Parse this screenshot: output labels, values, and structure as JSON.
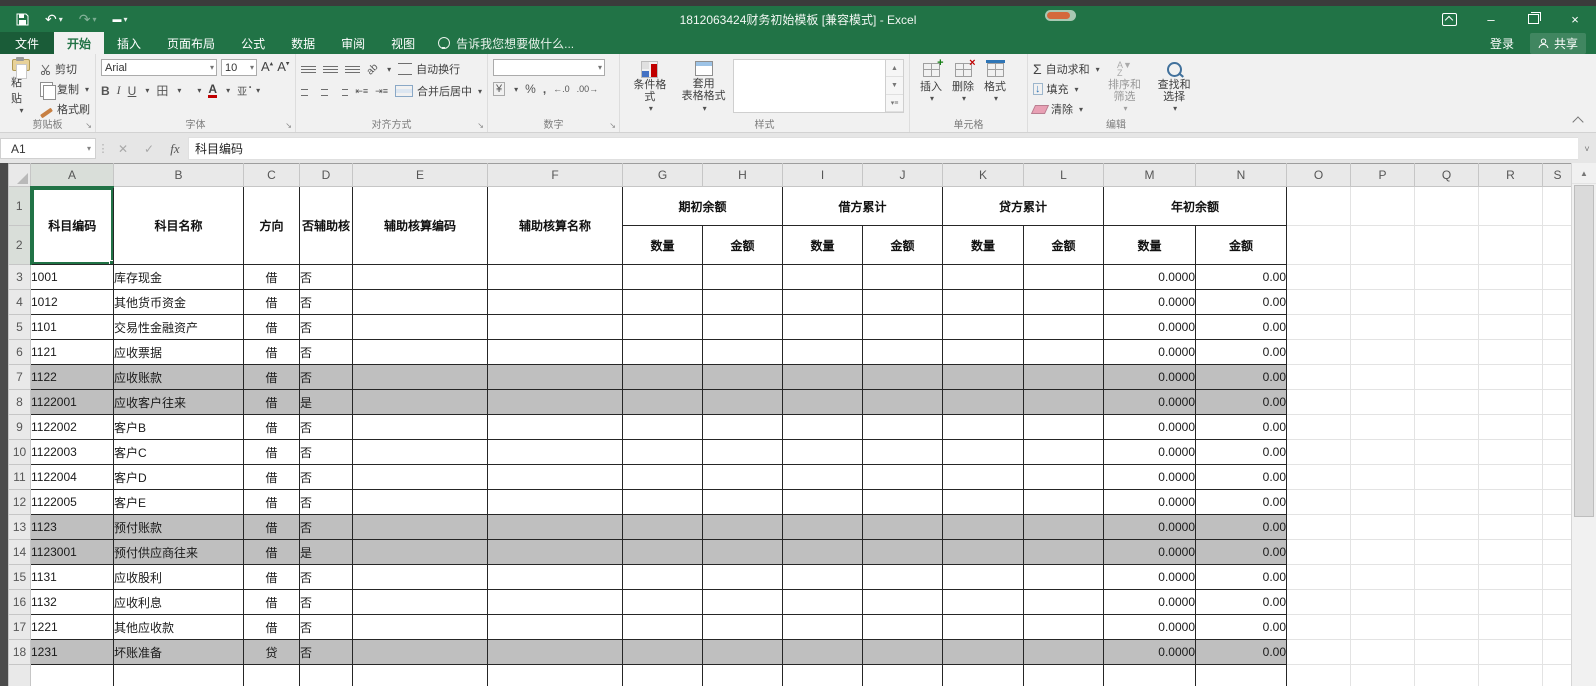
{
  "window": {
    "title": "1812063424财务初始模板  [兼容模式] - Excel",
    "sign_in": "登录",
    "share": "共享"
  },
  "tabs": {
    "file": "文件",
    "items": [
      "开始",
      "插入",
      "页面布局",
      "公式",
      "数据",
      "审阅",
      "视图"
    ],
    "selected": "开始",
    "tell_me": "告诉我您想要做什么..."
  },
  "ribbon": {
    "clipboard": {
      "group": "剪贴板",
      "paste": "粘贴",
      "cut": "剪切",
      "copy": "复制",
      "format_painter": "格式刷"
    },
    "font": {
      "group": "字体",
      "name_value": "Arial",
      "size_value": "10"
    },
    "alignment": {
      "group": "对齐方式",
      "wrap": "自动换行",
      "merge": "合并后居中"
    },
    "number": {
      "group": "数字"
    },
    "styles": {
      "group": "样式",
      "conditional": "条件格式",
      "format_table_line1": "套用",
      "format_table_line2": "表格格式"
    },
    "cells": {
      "group": "单元格",
      "insert": "插入",
      "delete": "删除",
      "format": "格式"
    },
    "editing": {
      "group": "编辑",
      "autosum": "自动求和",
      "fill": "填充",
      "clear": "清除",
      "sort": "排序和筛选",
      "find": "查找和选择"
    }
  },
  "formula_bar": {
    "name_box": "A1",
    "content": "科目编码"
  },
  "sheet": {
    "col_letters": [
      "A",
      "B",
      "C",
      "D",
      "E",
      "F",
      "G",
      "H",
      "I",
      "J",
      "K",
      "L",
      "M",
      "N",
      "O",
      "P",
      "Q",
      "R",
      "S"
    ],
    "selected_col": "A",
    "selected_rows": [
      "1",
      "2"
    ],
    "top_headers": [
      "科目编码",
      "科目名称",
      "方向",
      "否辅助核",
      "辅助核算编码",
      "辅助核算名称"
    ],
    "group_headers": [
      "期初余额",
      "借方累计",
      "贷方累计",
      "年初余额"
    ],
    "sub_headers": [
      "数量",
      "金额",
      "数量",
      "金额",
      "数量",
      "金额",
      "数量",
      "金额"
    ],
    "rows": [
      {
        "r": "3",
        "code": "1001",
        "name": "库存现金",
        "dir": "借",
        "aux": "否",
        "qty": "0.0000",
        "amt": "0.00",
        "gray": false
      },
      {
        "r": "4",
        "code": "1012",
        "name": "其他货币资金",
        "dir": "借",
        "aux": "否",
        "qty": "0.0000",
        "amt": "0.00",
        "gray": false
      },
      {
        "r": "5",
        "code": "1101",
        "name": "交易性金融资产",
        "dir": "借",
        "aux": "否",
        "qty": "0.0000",
        "amt": "0.00",
        "gray": false
      },
      {
        "r": "6",
        "code": "1121",
        "name": "应收票据",
        "dir": "借",
        "aux": "否",
        "qty": "0.0000",
        "amt": "0.00",
        "gray": false
      },
      {
        "r": "7",
        "code": "1122",
        "name": "应收账款",
        "dir": "借",
        "aux": "否",
        "qty": "0.0000",
        "amt": "0.00",
        "gray": true
      },
      {
        "r": "8",
        "code": "1122001",
        "name": "应收客户往来",
        "dir": "借",
        "aux": "是",
        "qty": "0.0000",
        "amt": "0.00",
        "gray": true
      },
      {
        "r": "9",
        "code": "1122002",
        "name": "客户B",
        "dir": "借",
        "aux": "否",
        "qty": "0.0000",
        "amt": "0.00",
        "gray": false
      },
      {
        "r": "10",
        "code": "1122003",
        "name": "客户C",
        "dir": "借",
        "aux": "否",
        "qty": "0.0000",
        "amt": "0.00",
        "gray": false
      },
      {
        "r": "11",
        "code": "1122004",
        "name": "客户D",
        "dir": "借",
        "aux": "否",
        "qty": "0.0000",
        "amt": "0.00",
        "gray": false
      },
      {
        "r": "12",
        "code": "1122005",
        "name": "客户E",
        "dir": "借",
        "aux": "否",
        "qty": "0.0000",
        "amt": "0.00",
        "gray": false
      },
      {
        "r": "13",
        "code": "1123",
        "name": "预付账款",
        "dir": "借",
        "aux": "否",
        "qty": "0.0000",
        "amt": "0.00",
        "gray": true
      },
      {
        "r": "14",
        "code": "1123001",
        "name": "预付供应商往来",
        "dir": "借",
        "aux": "是",
        "qty": "0.0000",
        "amt": "0.00",
        "gray": true
      },
      {
        "r": "15",
        "code": "1131",
        "name": "应收股利",
        "dir": "借",
        "aux": "否",
        "qty": "0.0000",
        "amt": "0.00",
        "gray": false
      },
      {
        "r": "16",
        "code": "1132",
        "name": "应收利息",
        "dir": "借",
        "aux": "否",
        "qty": "0.0000",
        "amt": "0.00",
        "gray": false
      },
      {
        "r": "17",
        "code": "1221",
        "name": "其他应收款",
        "dir": "借",
        "aux": "否",
        "qty": "0.0000",
        "amt": "0.00",
        "gray": false
      },
      {
        "r": "18",
        "code": "1231",
        "name": "坏账准备",
        "dir": "贷",
        "aux": "否",
        "qty": "0.0000",
        "amt": "0.00",
        "gray": true
      }
    ],
    "colors": {
      "accent_green": "#217346",
      "gray_row": "#bfbfbf",
      "table_border": "#262626",
      "gridline": "#e3e3e3"
    }
  }
}
